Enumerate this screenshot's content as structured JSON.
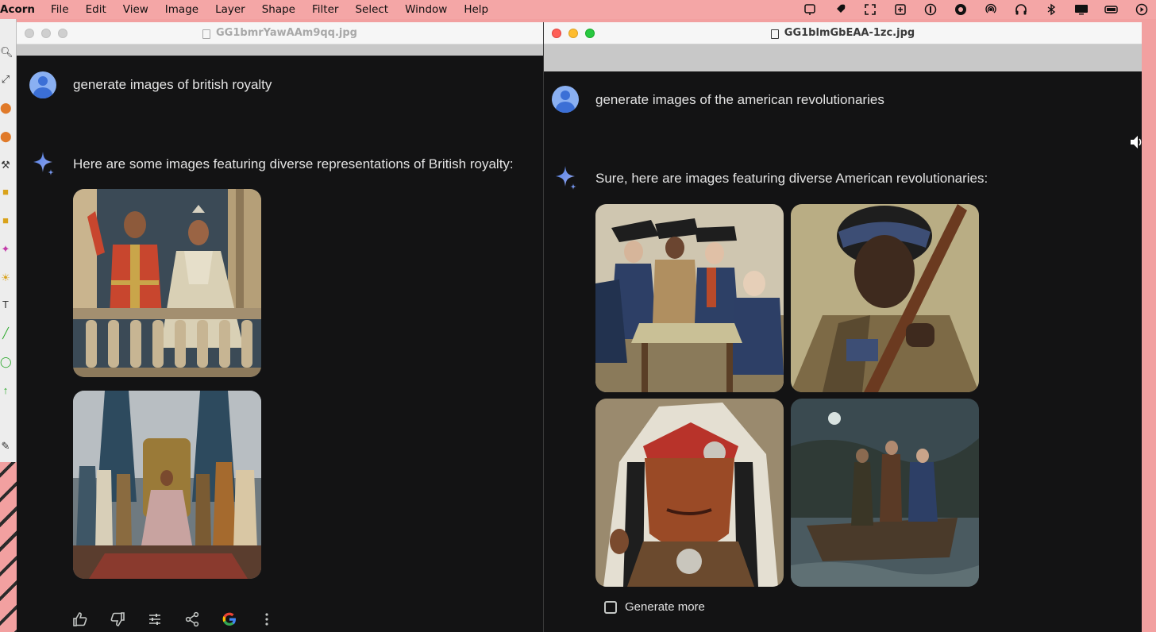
{
  "menubar": {
    "app": "Acorn",
    "items": [
      "File",
      "Edit",
      "View",
      "Image",
      "Layer",
      "Shape",
      "Filter",
      "Select",
      "Window",
      "Help"
    ],
    "tray_icons": [
      "news-icon",
      "rocket-icon",
      "expand-icon",
      "screenshot-icon",
      "one-password-icon",
      "swirl-icon",
      "airdrop-icon",
      "headphones-icon",
      "bluetooth-icon",
      "display-icon",
      "battery-icon",
      "play-icon"
    ]
  },
  "left_window": {
    "title": "GG1bmrYawAAm9qq.jpg",
    "prompt": "generate images of british royalty",
    "reply": "Here are some images featuring diverse representations of British royalty:",
    "images": [
      "royal-couple-on-balcony",
      "royal-court-throne-room"
    ],
    "actions": [
      "thumbs-up-icon",
      "thumbs-down-icon",
      "tune-icon",
      "share-icon",
      "google-icon",
      "more-icon"
    ]
  },
  "right_window": {
    "title": "GG1blmGbEAA-1zc.jpg",
    "prompt": "generate images of the american revolutionaries",
    "reply": "Sure, here are images featuring diverse American revolutionaries:",
    "images": [
      "revolutionaries-around-map",
      "woman-with-musket",
      "native-chief-headdress",
      "soldiers-in-boat"
    ],
    "generate_more": "Generate more"
  },
  "colors": {
    "chat_bg": "#131314",
    "text": "#e3e3e3",
    "accent": "#8ab0f2",
    "desktop": "#f2a0a0"
  }
}
